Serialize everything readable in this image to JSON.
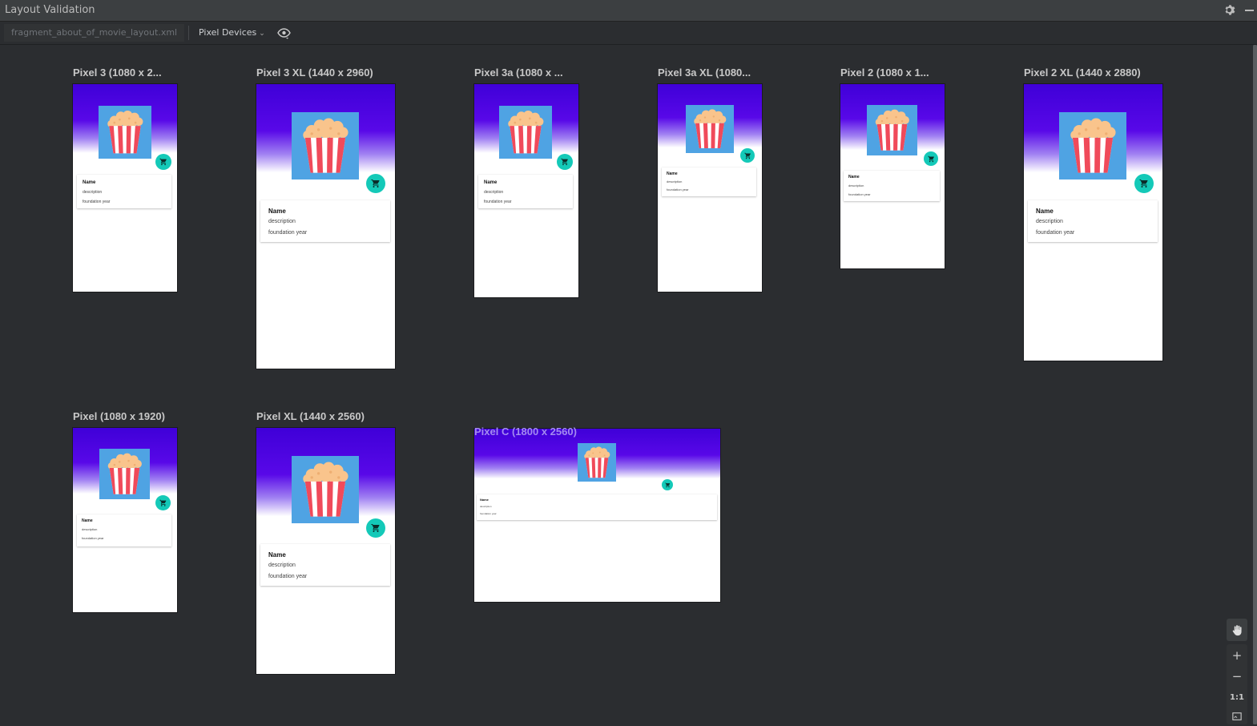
{
  "window": {
    "title": "Layout Validation"
  },
  "toolbar": {
    "file_tab": "fragment_about_of_movie_layout.xml",
    "device_set": "Pixel Devices"
  },
  "devices": [
    {
      "label": "Pixel 3 (1080 x 2..."
    },
    {
      "label": "Pixel 3 XL (1440 x 2960)"
    },
    {
      "label": "Pixel 3a (1080 x ..."
    },
    {
      "label": "Pixel 3a XL (1080..."
    },
    {
      "label": "Pixel 2 (1080 x 1..."
    },
    {
      "label": "Pixel 2 XL (1440 x 2880)"
    },
    {
      "label": "Pixel (1080 x 1920)"
    },
    {
      "label": "Pixel XL (1440 x 2560)"
    },
    {
      "label": "Pixel C (1800 x 2560)"
    }
  ],
  "card": {
    "name": "Name",
    "description": "description",
    "year": "foundation year"
  },
  "zoom_controls": {
    "zoom_in": "+",
    "zoom_out": "−",
    "actual_size": "1:1"
  },
  "colors": {
    "hero_top": "#3f00d8",
    "poster_bg": "#4fa3e3",
    "fab": "#14c9b8",
    "popcorn_stripe_red": "#f04a5a",
    "popcorn_kernel": "#f9c48c",
    "highlight_label": "#a48bf0"
  },
  "icons": {
    "settings": "gear-icon",
    "minimize": "minimize-icon",
    "device_dropdown": "chevron-down-icon",
    "visibility": "eye-icon",
    "fab": "cart-icon",
    "pan": "hand-icon",
    "fit": "fit-screen-icon"
  }
}
